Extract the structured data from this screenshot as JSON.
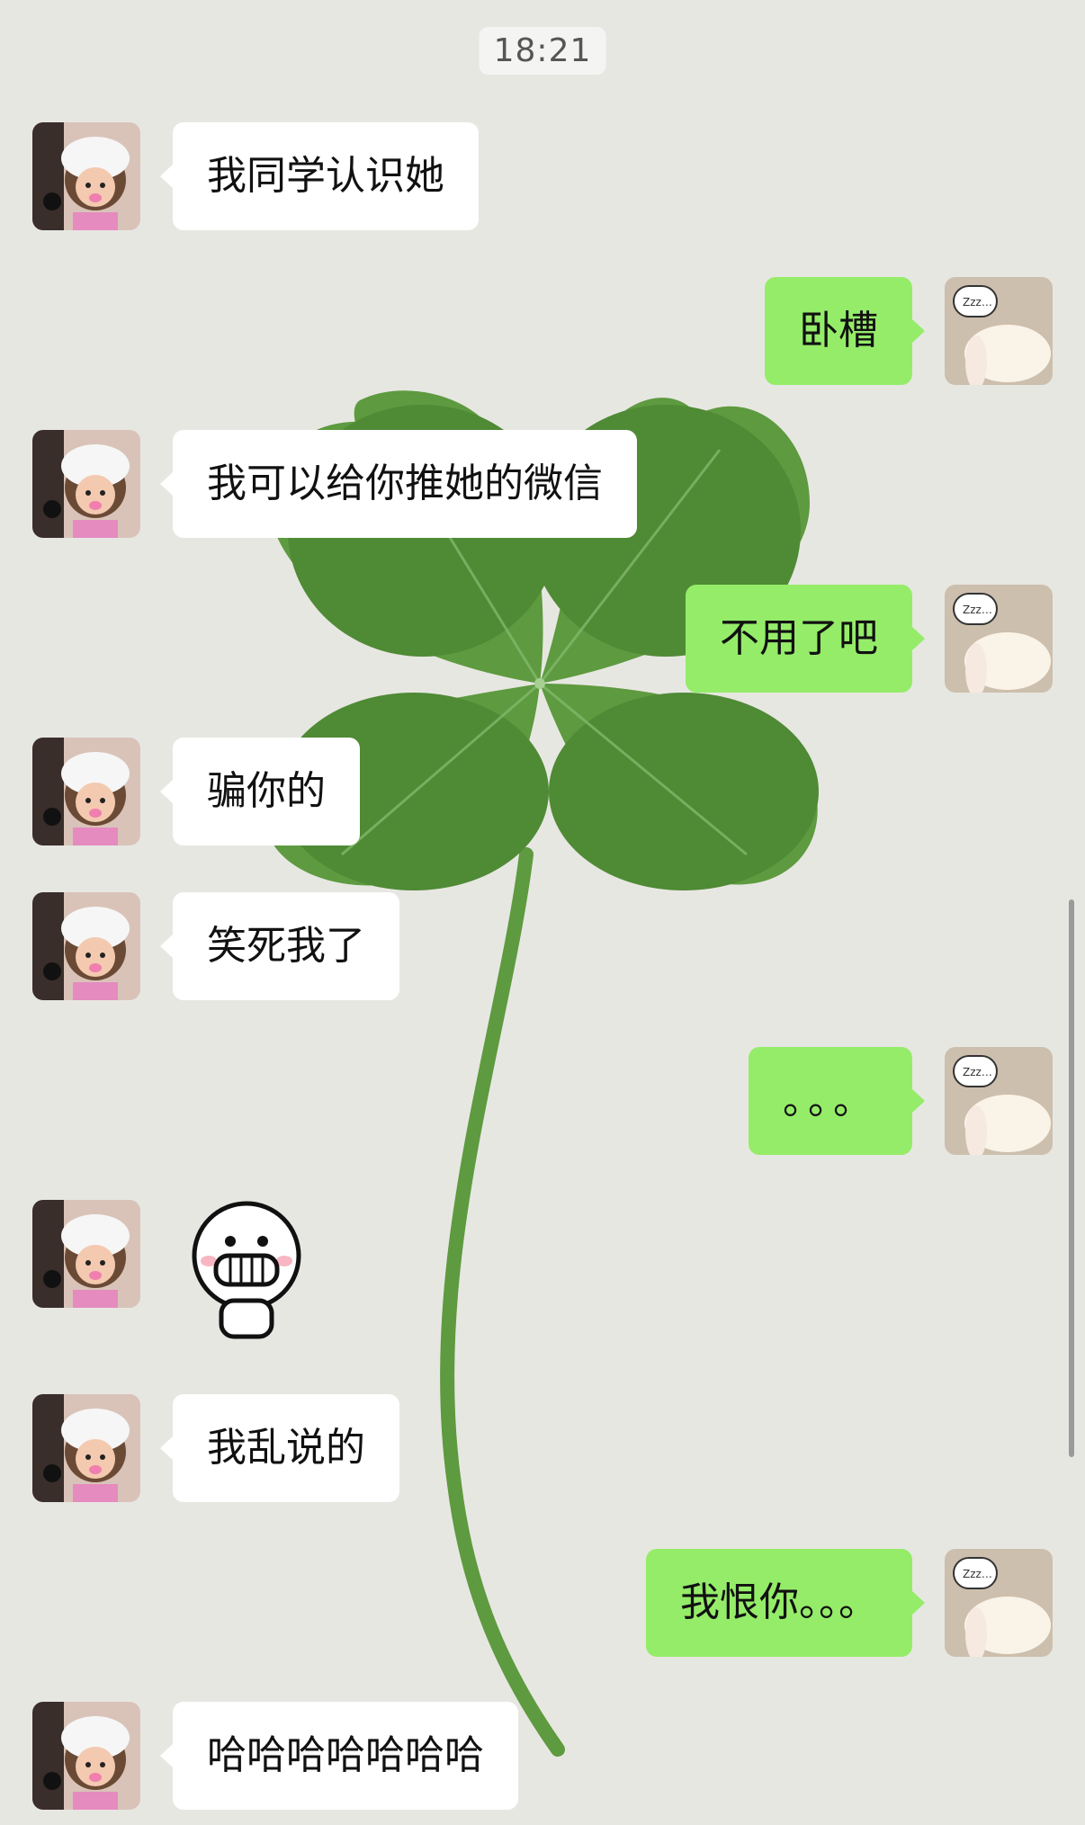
{
  "chat": {
    "timestamp": "18:21",
    "background": {
      "description": "four-leaf-clover",
      "leaf_color": "#5e9a3f",
      "paper_color": "#e6e6e1"
    },
    "colors": {
      "incoming_bubble": "#ffffff",
      "outgoing_bubble": "#95ec69"
    },
    "messages": [
      {
        "side": "in",
        "text": "我同学认识她"
      },
      {
        "side": "out",
        "text": "卧槽"
      },
      {
        "side": "in",
        "text": "我可以给你推她的微信"
      },
      {
        "side": "out",
        "text": "不用了吧"
      },
      {
        "side": "in",
        "text": "骗你的"
      },
      {
        "side": "in",
        "text": "笑死我了"
      },
      {
        "side": "out",
        "text": "。。。"
      },
      {
        "side": "in",
        "sticker": "grinning-face-sticker"
      },
      {
        "side": "in",
        "text": "我乱说的"
      },
      {
        "side": "out",
        "text": "我恨你。。。"
      },
      {
        "side": "in",
        "text": "哈哈哈哈哈哈哈"
      }
    ]
  }
}
